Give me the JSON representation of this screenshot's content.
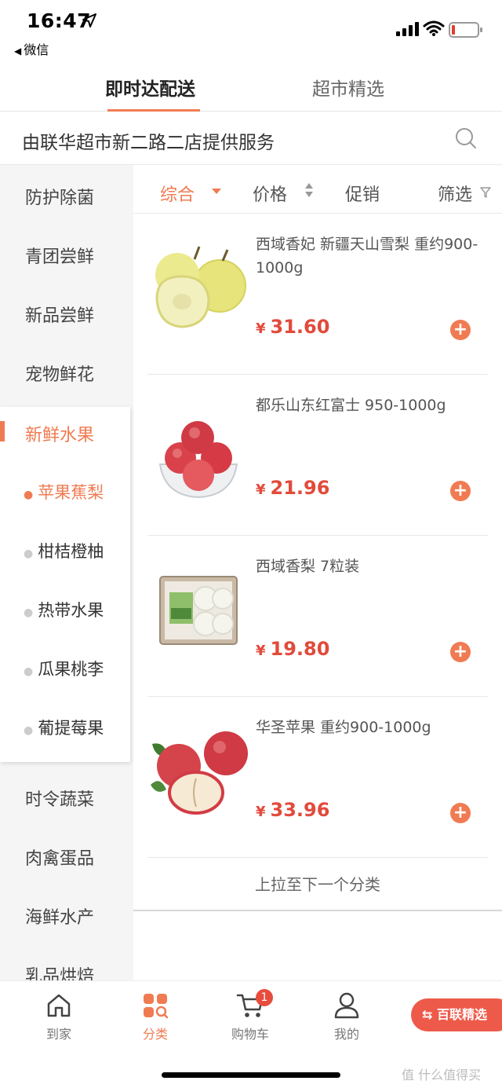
{
  "status": {
    "time": "16:47",
    "back_app": "微信"
  },
  "tabs": [
    {
      "label": "即时达配送"
    },
    {
      "label": "超市精选"
    }
  ],
  "store": {
    "text": "由联华超市新二路二店提供服务"
  },
  "sidebar": {
    "items_top": [
      "防护除菌",
      "青团尝鲜",
      "新品尝鲜",
      "宠物鲜花"
    ],
    "active": "新鲜水果",
    "subitems": [
      "苹果蕉梨",
      "柑桔橙柚",
      "热带水果",
      "瓜果桃李",
      "葡提莓果"
    ],
    "items_bottom": [
      "时令蔬菜",
      "肉禽蛋品",
      "海鲜水产",
      "乳品烘焙"
    ]
  },
  "filters": {
    "comprehensive": "综合",
    "price": "价格",
    "promo": "促销",
    "filter": "筛选"
  },
  "products": [
    {
      "name": "西域香妃 新疆天山雪梨  重约900-1000g",
      "currency": "¥",
      "price": "31.60"
    },
    {
      "name": "都乐山东红富士 950-1000g",
      "currency": "¥",
      "price": "21.96"
    },
    {
      "name": "西域香梨 7粒装",
      "currency": "¥",
      "price": "19.80"
    },
    {
      "name": "华圣苹果  重约900-1000g",
      "currency": "¥",
      "price": "33.96"
    }
  ],
  "pull_hint": "上拉至下一个分类",
  "nav": {
    "home": "到家",
    "category": "分类",
    "cart": "购物车",
    "cart_count": "1",
    "mine": "我的",
    "bailian": "百联精选"
  },
  "watermark": "什么值得买",
  "colors": {
    "accent": "#f07b52",
    "price": "#e24a3b",
    "badge": "#e84c3d"
  }
}
